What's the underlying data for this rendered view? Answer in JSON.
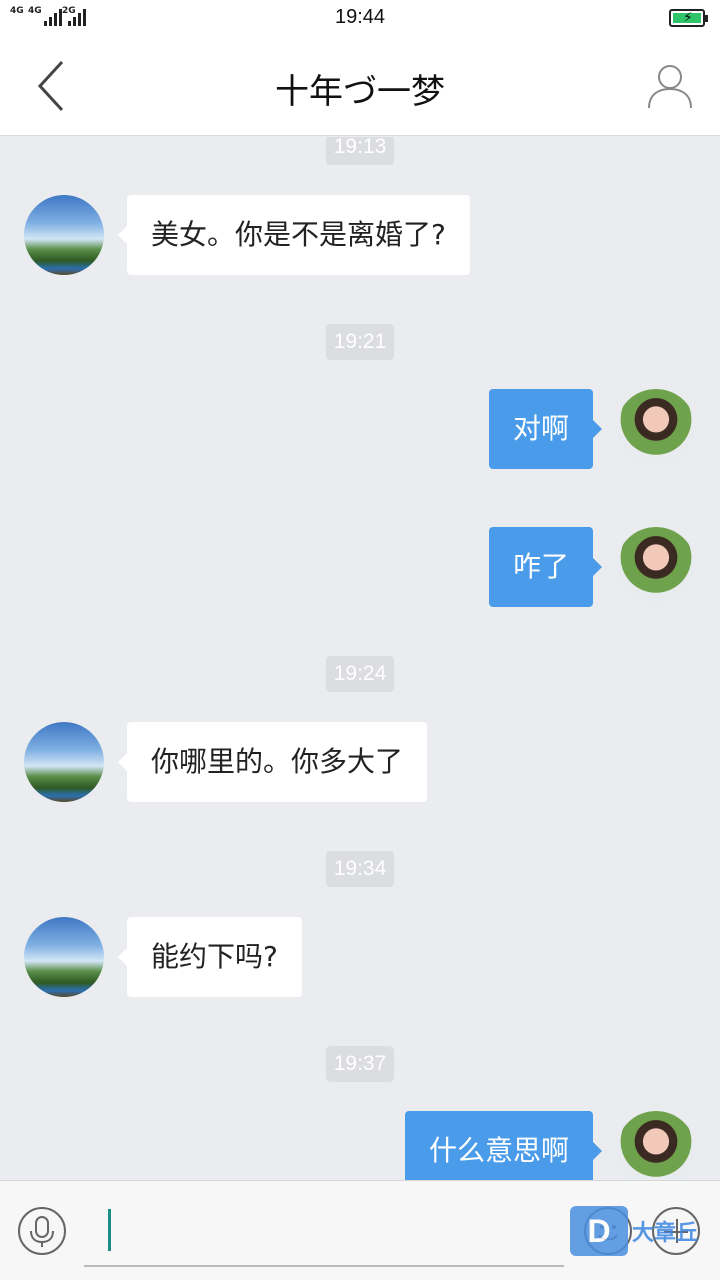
{
  "status_bar": {
    "sig1": "4G",
    "sig2": "4G",
    "sig3": "2G",
    "time": "19:44"
  },
  "nav": {
    "title": "十年づ一梦",
    "back_icon": "chevron-left-icon",
    "profile_icon": "person-outline-icon"
  },
  "messages": [
    {
      "kind": "time",
      "text": "19:13"
    },
    {
      "kind": "msg",
      "side": "left",
      "text": "美女。你是不是离婚了?"
    },
    {
      "kind": "time",
      "text": "19:21"
    },
    {
      "kind": "msg",
      "side": "right",
      "text": "对啊"
    },
    {
      "kind": "msg",
      "side": "right",
      "text": "咋了"
    },
    {
      "kind": "time",
      "text": "19:24"
    },
    {
      "kind": "msg",
      "side": "left",
      "text": "你哪里的。你多大了"
    },
    {
      "kind": "time",
      "text": "19:34"
    },
    {
      "kind": "msg",
      "side": "left",
      "text": "能约下吗?"
    },
    {
      "kind": "time",
      "text": "19:37"
    },
    {
      "kind": "msg",
      "side": "right",
      "text": "什么意思啊"
    }
  ],
  "input_bar": {
    "voice_icon": "microphone-icon",
    "emoji_icon": "smiley-icon",
    "plus_icon": "plus-icon",
    "watermark_logo": "D",
    "watermark_text": "大章丘"
  },
  "colors": {
    "outgoing_bubble": "#4a9cea",
    "incoming_bubble": "#ffffff",
    "chat_background": "#ebecef"
  }
}
